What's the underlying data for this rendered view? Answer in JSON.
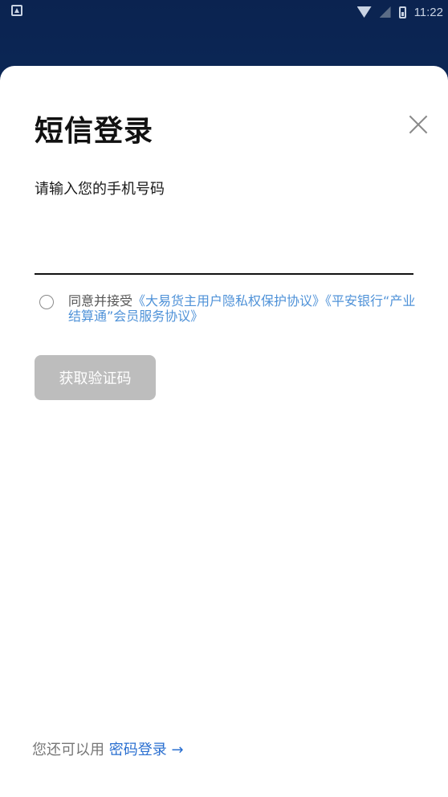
{
  "status_bar": {
    "time": "11:22",
    "icons": [
      "notification-icon",
      "wifi-icon",
      "signal-icon",
      "battery-icon"
    ]
  },
  "dialog": {
    "title": "短信登录",
    "close_icon": "close-icon"
  },
  "phone": {
    "label": "请输入您的手机号码",
    "value": "",
    "placeholder": ""
  },
  "agreement": {
    "prefix": "同意并接受",
    "link1": "《大易货主用户隐私权保护协议》",
    "link2": "《平安银行“产业结算通”会员服务协议》",
    "checked": false
  },
  "actions": {
    "get_code_label": "获取验证码"
  },
  "footer": {
    "prefix": "您还可以用 ",
    "password_login_label": "密码登录 →"
  },
  "colors": {
    "link": "#4f92d8",
    "password_link": "#2a6fd0",
    "disabled_button": "#bdbdbd",
    "header_bg": "#0d3870"
  }
}
